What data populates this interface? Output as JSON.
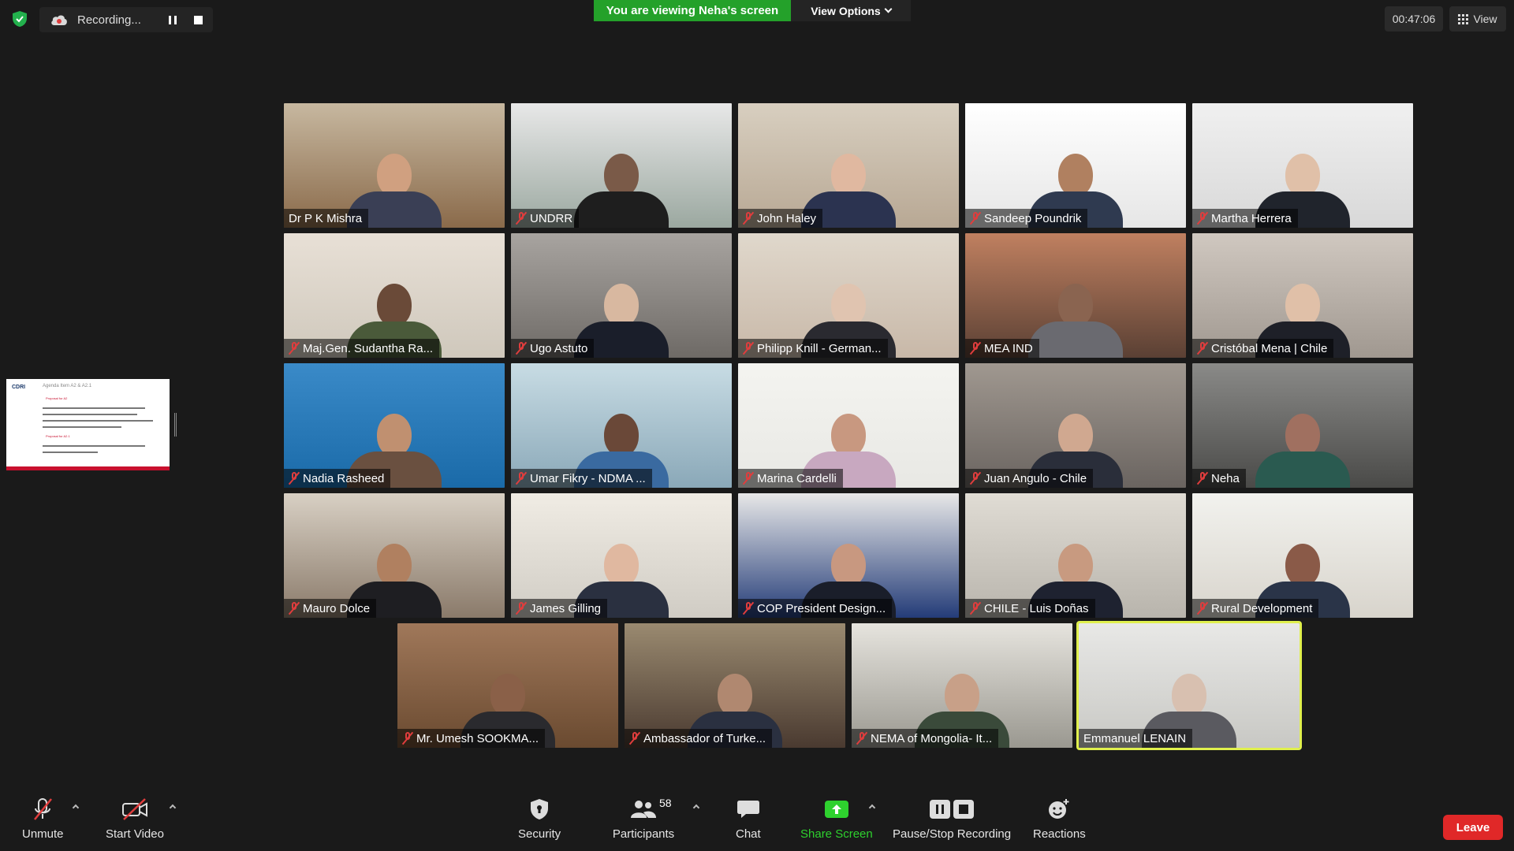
{
  "top_bar": {
    "recording_label": "Recording...",
    "viewing_banner": "You are viewing Neha's screen",
    "view_options_label": "View Options",
    "timer": "00:47:06",
    "view_label": "View"
  },
  "shared_screen_thumbnail": {
    "logo_text": "CDRI",
    "agenda_title": "Agenda Item A2 & A2.1",
    "bullet_1": "Proposal for A2",
    "bullet_2": "Proposal for A2.1"
  },
  "participants": [
    {
      "name": "Dr P K Mishra",
      "muted": false
    },
    {
      "name": "UNDRR",
      "muted": true
    },
    {
      "name": "John Haley",
      "muted": true
    },
    {
      "name": "Sandeep Poundrik",
      "muted": true
    },
    {
      "name": "Martha Herrera",
      "muted": true
    },
    {
      "name": "Maj.Gen. Sudantha Ra...",
      "muted": true
    },
    {
      "name": "Ugo Astuto",
      "muted": true
    },
    {
      "name": "Philipp Knill - German...",
      "muted": true
    },
    {
      "name": "MEA IND",
      "muted": true
    },
    {
      "name": "Cristóbal Mena | Chile",
      "muted": true
    },
    {
      "name": "Nadia Rasheed",
      "muted": true
    },
    {
      "name": "Umar Fikry - NDMA ...",
      "muted": true
    },
    {
      "name": "Marina Cardelli",
      "muted": true
    },
    {
      "name": "Juan Angulo - Chile",
      "muted": true
    },
    {
      "name": "Neha",
      "muted": true
    },
    {
      "name": "Mauro Dolce",
      "muted": true
    },
    {
      "name": "James Gilling",
      "muted": true
    },
    {
      "name": "COP President Design...",
      "muted": true
    },
    {
      "name": "CHILE - Luis Doñas",
      "muted": true
    },
    {
      "name": "Rural Development",
      "muted": true
    },
    {
      "name": "Mr. Umesh SOOKMA...",
      "muted": true
    },
    {
      "name": "Ambassador of Turke...",
      "muted": true
    },
    {
      "name": "NEMA of Mongolia- It...",
      "muted": true
    },
    {
      "name": "Emmanuel LENAIN",
      "muted": false,
      "active_speaker": true
    }
  ],
  "toolbar": {
    "unmute": "Unmute",
    "start_video": "Start Video",
    "security": "Security",
    "participants": "Participants",
    "participants_count": "58",
    "chat": "Chat",
    "share_screen": "Share Screen",
    "pause_stop_recording": "Pause/Stop Recording",
    "reactions": "Reactions",
    "leave": "Leave"
  },
  "colors": {
    "background": "#1a1a1a",
    "banner_green": "#24a12a",
    "share_green": "#2ed12e",
    "leave_red": "#e02828",
    "muted_red": "#e03d3d",
    "active_speaker_border": "#e0f04d"
  }
}
